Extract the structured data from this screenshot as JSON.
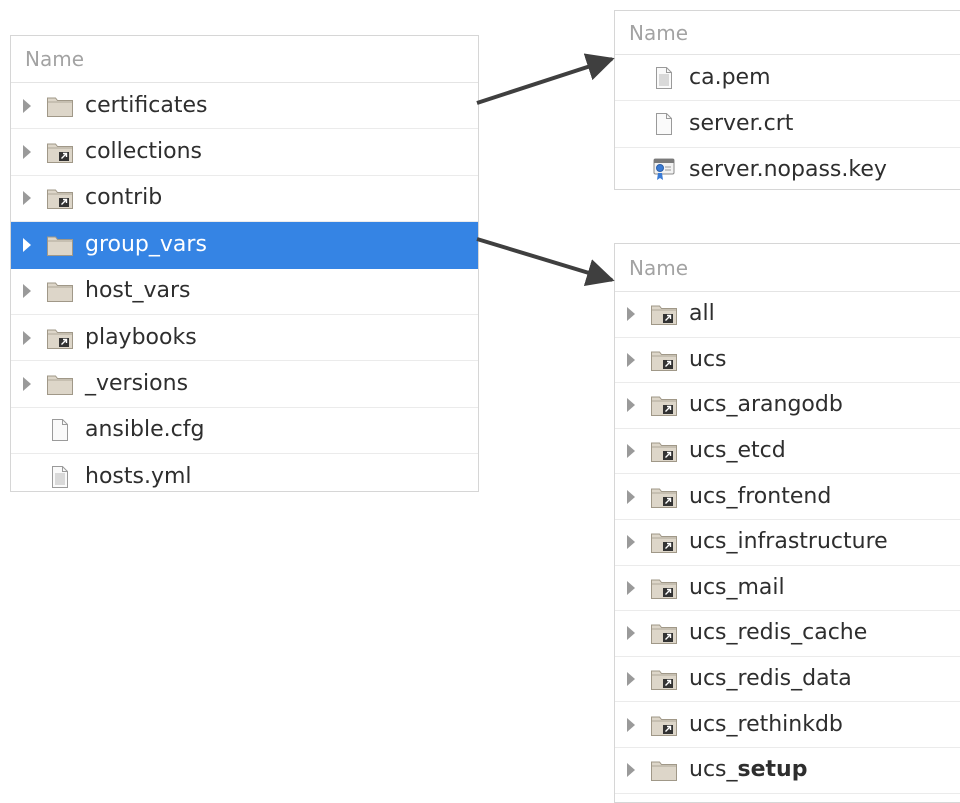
{
  "panels": {
    "root": {
      "header": "Name",
      "rows": [
        {
          "label": "certificates",
          "icon": "folder-icon",
          "expandable": true
        },
        {
          "label": "collections",
          "icon": "folder-link-icon",
          "expandable": true
        },
        {
          "label": "contrib",
          "icon": "folder-link-icon",
          "expandable": true
        },
        {
          "label": "group_vars",
          "icon": "folder-icon",
          "expandable": true,
          "selected": true
        },
        {
          "label": "host_vars",
          "icon": "folder-icon",
          "expandable": true
        },
        {
          "label": "playbooks",
          "icon": "folder-link-icon",
          "expandable": true
        },
        {
          "label": "_versions",
          "icon": "folder-icon",
          "expandable": true
        },
        {
          "label": "ansible.cfg",
          "icon": "file-icon",
          "expandable": false
        },
        {
          "label": "hosts.yml",
          "icon": "text-file-icon",
          "expandable": false
        }
      ]
    },
    "certificates": {
      "header": "Name",
      "rows": [
        {
          "label": "ca.pem",
          "icon": "text-file-icon"
        },
        {
          "label": "server.crt",
          "icon": "file-icon"
        },
        {
          "label": "server.nopass.key",
          "icon": "certificate-icon"
        }
      ]
    },
    "group_vars": {
      "header": "Name",
      "rows": [
        {
          "label": "all",
          "icon": "folder-link-icon"
        },
        {
          "label": "ucs",
          "icon": "folder-link-icon"
        },
        {
          "label": "ucs_arangodb",
          "icon": "folder-link-icon"
        },
        {
          "label": "ucs_etcd",
          "icon": "folder-link-icon"
        },
        {
          "label": "ucs_frontend",
          "icon": "folder-link-icon"
        },
        {
          "label": "ucs_infrastructure",
          "icon": "folder-link-icon"
        },
        {
          "label": "ucs_mail",
          "icon": "folder-link-icon"
        },
        {
          "label": "ucs_redis_cache",
          "icon": "folder-link-icon"
        },
        {
          "label": "ucs_redis_data",
          "icon": "folder-link-icon"
        },
        {
          "label": "ucs_rethinkdb",
          "icon": "folder-link-icon"
        },
        {
          "label_prefix": "ucs_",
          "label_bold": "setup",
          "icon": "folder-icon"
        }
      ]
    }
  },
  "colors": {
    "selection": "#3584e4",
    "folder_fill": "#ddd6c9",
    "folder_stroke": "#a09888",
    "arrow": "#3f3f3f"
  }
}
